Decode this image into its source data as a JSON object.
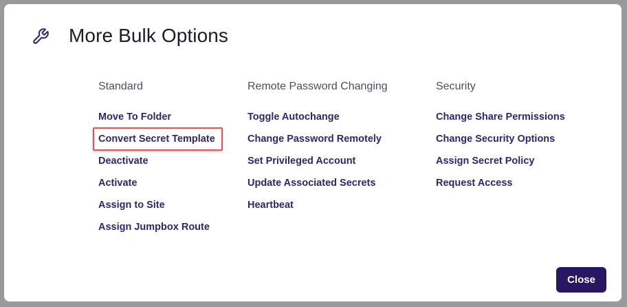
{
  "dialog": {
    "title": "More Bulk Options",
    "icon": "wrench-icon",
    "accent_color": "#2a1763",
    "link_color": "#302567",
    "highlight_color": "#e05454"
  },
  "columns": {
    "standard": {
      "heading": "Standard",
      "items": [
        "Move To Folder",
        "Convert Secret Template",
        "Deactivate",
        "Activate",
        "Assign to Site",
        "Assign Jumpbox Route"
      ]
    },
    "rpc": {
      "heading": "Remote Password Changing",
      "items": [
        "Toggle Autochange",
        "Change Password Remotely",
        "Set Privileged Account",
        "Update Associated Secrets",
        "Heartbeat"
      ]
    },
    "security": {
      "heading": "Security",
      "items": [
        "Change Share Permissions",
        "Change Security Options",
        "Assign Secret Policy",
        "Request Access"
      ]
    }
  },
  "footer": {
    "close_label": "Close"
  }
}
